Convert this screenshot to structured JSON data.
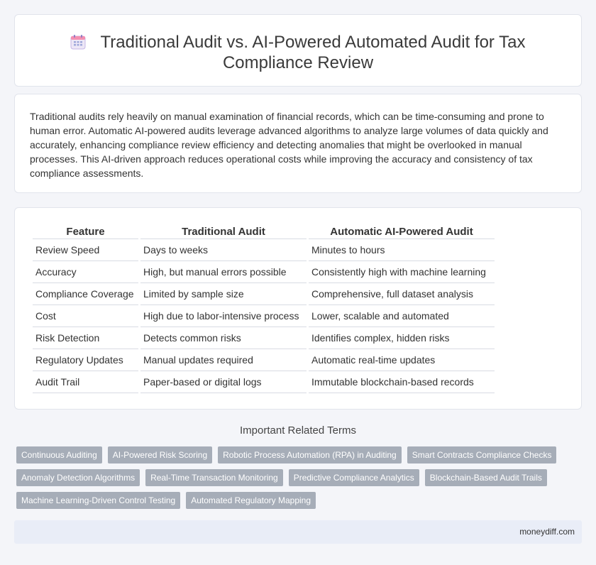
{
  "header": {
    "title": "Traditional Audit vs. AI-Powered Automated Audit for Tax Compliance Review",
    "icon": "calendar-icon"
  },
  "intro": {
    "text": "Traditional audits rely heavily on manual examination of financial records, which can be time-consuming and prone to human error. Automatic AI-powered audits leverage advanced algorithms to analyze large volumes of data quickly and accurately, enhancing compliance review efficiency and detecting anomalies that might be overlooked in manual processes. This AI-driven approach reduces operational costs while improving the accuracy and consistency of tax compliance assessments."
  },
  "table": {
    "headers": [
      "Feature",
      "Traditional Audit",
      "Automatic AI-Powered Audit"
    ],
    "rows": [
      [
        "Review Speed",
        "Days to weeks",
        "Minutes to hours"
      ],
      [
        "Accuracy",
        "High, but manual errors possible",
        "Consistently high with machine learning"
      ],
      [
        "Compliance Coverage",
        "Limited by sample size",
        "Comprehensive, full dataset analysis"
      ],
      [
        "Cost",
        "High due to labor-intensive process",
        "Lower, scalable and automated"
      ],
      [
        "Risk Detection",
        "Detects common risks",
        "Identifies complex, hidden risks"
      ],
      [
        "Regulatory Updates",
        "Manual updates required",
        "Automatic real-time updates"
      ],
      [
        "Audit Trail",
        "Paper-based or digital logs",
        "Immutable blockchain-based records"
      ]
    ]
  },
  "related": {
    "heading": "Important Related Terms",
    "tags": [
      "Continuous Auditing",
      "AI-Powered Risk Scoring",
      "Robotic Process Automation (RPA) in Auditing",
      "Smart Contracts Compliance Checks",
      "Anomaly Detection Algorithms",
      "Real-Time Transaction Monitoring",
      "Predictive Compliance Analytics",
      "Blockchain-Based Audit Trails",
      "Machine Learning-Driven Control Testing",
      "Automated Regulatory Mapping"
    ]
  },
  "footer": {
    "site": "moneydiff.com"
  },
  "colors": {
    "tag_bg": "#a6adb8",
    "footer_bg": "#e9edf7",
    "page_bg": "#f4f5f9"
  }
}
